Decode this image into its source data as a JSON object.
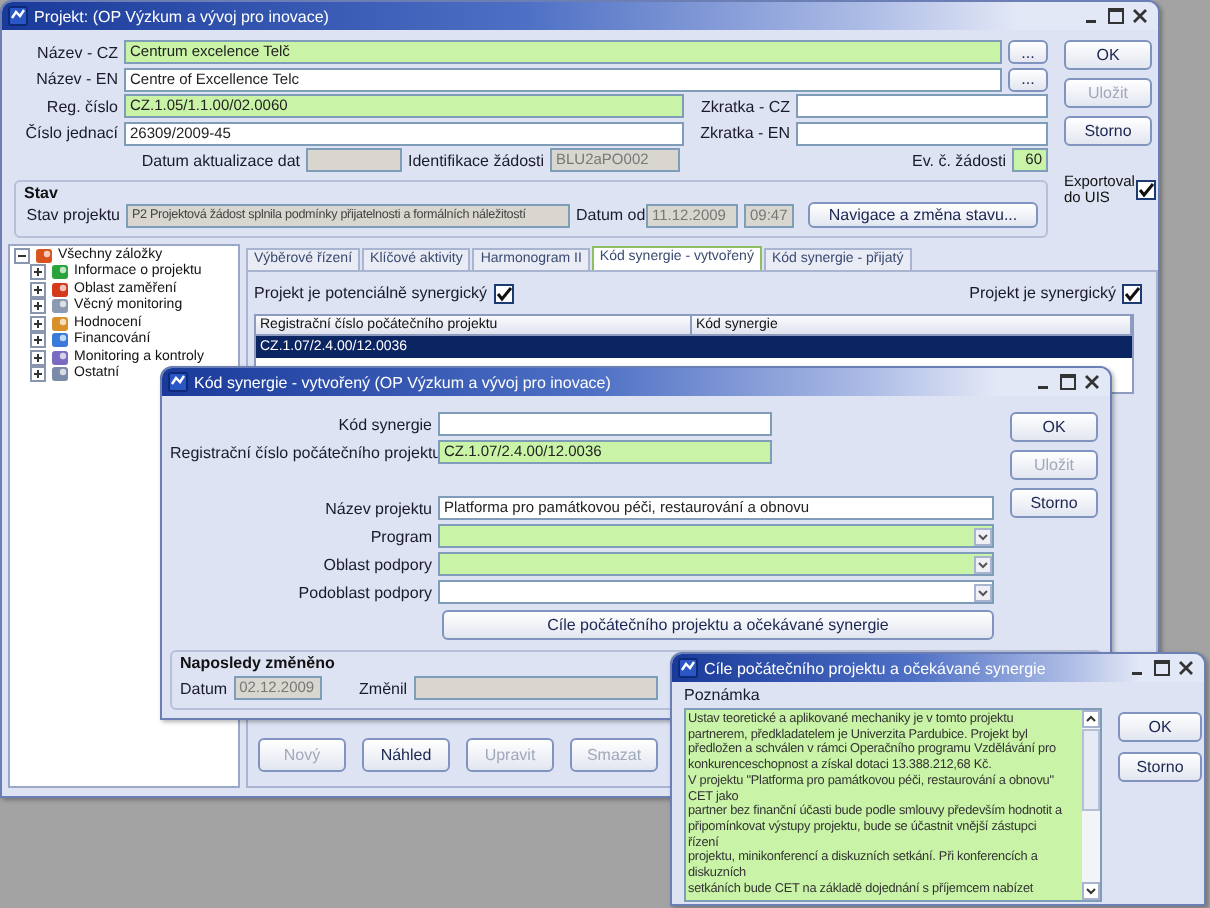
{
  "main_window": {
    "title": "Projekt:  (OP Výzkum a vývoj pro inovace)",
    "name_fields": [
      {
        "label": "Název - CZ",
        "value": "Centrum excelence Telč",
        "required": true,
        "button": "..."
      },
      {
        "label": "Název - EN",
        "value": "Centre of Excellence Telc",
        "required": false,
        "button": "..."
      }
    ],
    "id_rows": [
      {
        "label": "Reg. číslo",
        "value": "CZ.1.05/1.1.00/02.0060",
        "required": true,
        "right_label": "Zkratka - CZ"
      },
      {
        "label": "Číslo jednací",
        "value": "26309/2009-45",
        "required": false,
        "right_label": "Zkratka - EN"
      }
    ],
    "info_row": {
      "update_label": "Datum aktualizace dat",
      "request_label": "Identifikace žádosti",
      "request_value": "BLU2aPO002",
      "ev_label": "Ev. č. žádosti",
      "ev_value": "60"
    },
    "status_group": {
      "title": "Stav",
      "label": "Stav projektu",
      "value": "P2 Projektová žádost splnila podmínky přijatelnosti a formálních náležitostí",
      "date_label": "Datum od",
      "date": "11.12.2009",
      "time": "09:47",
      "button": "Navigace a změna stavu..."
    },
    "buttons": [
      {
        "label": "OK",
        "disabled": false
      },
      {
        "label": "Uložit",
        "disabled": true
      },
      {
        "label": "Storno",
        "disabled": false
      }
    ],
    "export": {
      "label": "Exportoval do UIS",
      "checked": true
    },
    "tree": [
      {
        "label": "Všechny záložky",
        "expanded": true,
        "children": [
          {
            "label": "Informace o projektu",
            "expanded": false
          },
          {
            "label": "Oblast zaměření",
            "expanded": false
          },
          {
            "label": "Věcný monitoring",
            "expanded": false
          },
          {
            "label": "Hodnocení",
            "expanded": false
          },
          {
            "label": "Financování",
            "expanded": false
          },
          {
            "label": "Monitoring a kontroly",
            "expanded": false
          },
          {
            "label": "Ostatní",
            "expanded": false
          }
        ]
      }
    ],
    "tabs": [
      {
        "label": "Výběrové řízení",
        "selected": false
      },
      {
        "label": "Klíčové aktivity",
        "selected": false
      },
      {
        "label": "Harmonogram II",
        "selected": false
      },
      {
        "label": "Kód synergie - vytvořený",
        "selected": true
      },
      {
        "label": "Kód synergie - přijatý",
        "selected": false
      }
    ],
    "potential_synergy": {
      "label": "Projekt je potenciálně synergický",
      "checked": true
    },
    "synergy": {
      "label": "Projekt je synergický",
      "checked": true
    },
    "table": {
      "columns": [
        "Registrační číslo počátečního projektu",
        "Kód synergie"
      ],
      "rows": [
        {
          "cells": [
            "CZ.1.07/2.4.00/12.0036"
          ],
          "selected": true
        }
      ]
    },
    "bottom_buttons": [
      {
        "label": "Nový",
        "disabled": true
      },
      {
        "label": "Náhled",
        "disabled": false
      },
      {
        "label": "Upravit",
        "disabled": true
      },
      {
        "label": "Smazat",
        "disabled": true
      }
    ]
  },
  "synergy_window": {
    "title": "Kód synergie - vytvořený   (OP Výzkum a vývoj pro inovace)",
    "top_fields": [
      {
        "label": "Kód synergie",
        "required": false
      },
      {
        "label": "Registrační číslo počátečního projektu",
        "value": "CZ.1.07/2.4.00/12.0036",
        "required": true
      }
    ],
    "project_fields": [
      {
        "kind": "text",
        "label": "Název projektu",
        "value": "Platforma pro památkovou péči, restaurování a obnovu",
        "required": false
      },
      {
        "kind": "select",
        "label": "Program",
        "required": true
      },
      {
        "kind": "select",
        "label": "Oblast podpory",
        "required": true
      },
      {
        "kind": "select",
        "label": "Podoblast podpory",
        "required": false
      }
    ],
    "goals_button": "Cíle počátečního projektu a očekávané synergie",
    "buttons": [
      {
        "label": "OK",
        "disabled": false
      },
      {
        "label": "Uložit",
        "disabled": true
      },
      {
        "label": "Storno",
        "disabled": false
      }
    ],
    "last_changed": {
      "title": "Naposledy změněno",
      "date_label": "Datum",
      "date": "02.12.2009",
      "changed_by_label": "Změnil"
    }
  },
  "goals_window": {
    "title": "Cíle počátečního projektu a očekávané synergie",
    "note_label": "Poznámka",
    "note": "Ustav teoretické a aplikované mechaniky je v tomto projektu\npartnerem, předkladatelem je Univerzita Pardubice. Projekt byl\npředložen a schválen v rámci Operačního programu Vzdělávání pro\nkonkurenceschopnost a získal dotaci 13.388.212,68 Kč.\nV projektu \"Platforma pro památkovou péči, restaurování a obnovu\"\nCET jako\npartner bez finanční účasti bude podle smlouvy především hodnotit a\npřipomínkovat výstupy projektu, bude se účastnit vnější zástupci\nřízení\nprojektu, minikonferencí a diskuzních setkání. Při konferencích a\ndiskuzních\nsetkáních bude CET na základě dojednání s příjemcem nabízet",
    "buttons": [
      {
        "label": "OK",
        "disabled": false
      },
      {
        "label": "Storno",
        "disabled": false
      }
    ]
  }
}
